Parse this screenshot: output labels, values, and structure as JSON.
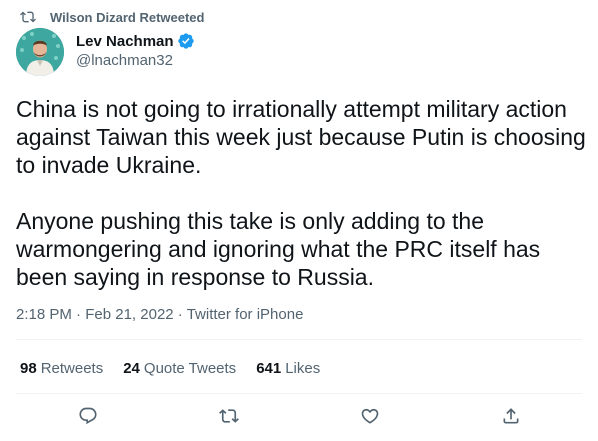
{
  "retweeted_by": {
    "label": "Wilson Dizard Retweeted"
  },
  "author": {
    "name": "Lev Nachman",
    "handle": "@lnachman32"
  },
  "tweet": {
    "paragraphs": [
      "China is not going to irrationally attempt military action against Taiwan this week just because Putin is choosing to invade Ukraine.",
      "Anyone pushing this take is only adding to the warmongering and ignoring what the PRC itself has been saying in response to Russia."
    ]
  },
  "meta": {
    "time": "2:18 PM",
    "date": "Feb 21, 2022",
    "separator": "·",
    "source": "Twitter for iPhone"
  },
  "stats": {
    "retweets": {
      "count": "98",
      "label": "Retweets"
    },
    "quote_tweets": {
      "count": "24",
      "label": "Quote Tweets"
    },
    "likes": {
      "count": "641",
      "label": "Likes"
    }
  },
  "actions": {
    "icons": [
      "reply-icon",
      "retweet-icon",
      "like-icon",
      "share-icon"
    ]
  },
  "colors": {
    "text": "#0f1419",
    "secondary": "#536471",
    "verified": "#1d9bf0",
    "divider": "#eff3f4"
  }
}
